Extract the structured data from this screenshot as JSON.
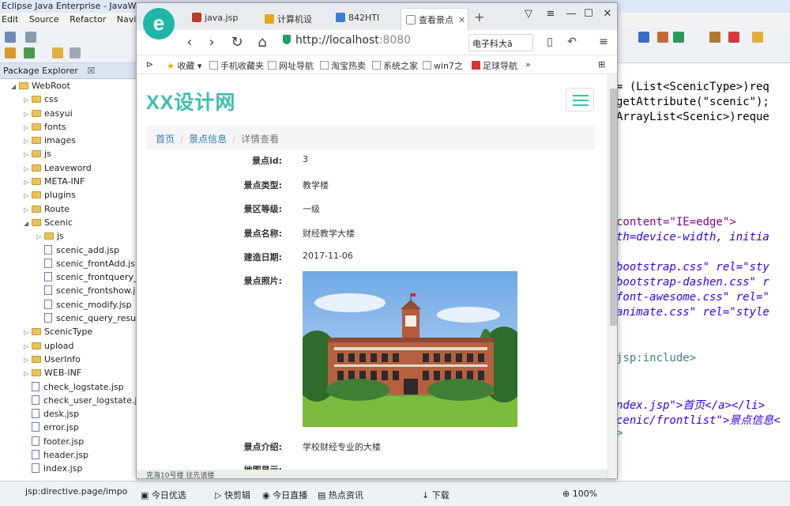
{
  "eclipse": {
    "title": "Eclipse Java Enterprise - JavaWebP",
    "menu": [
      "Edit",
      "Source",
      "Refactor",
      "Navigat"
    ],
    "package_explorer": {
      "title": "Package Explorer",
      "close": "☒",
      "items": [
        {
          "label": "WebRoot",
          "type": "folder",
          "depth": 0,
          "open": true
        },
        {
          "label": "css",
          "type": "folder",
          "depth": 1
        },
        {
          "label": "easyui",
          "type": "folder",
          "depth": 1
        },
        {
          "label": "fonts",
          "type": "folder",
          "depth": 1
        },
        {
          "label": "images",
          "type": "folder",
          "depth": 1
        },
        {
          "label": "js",
          "type": "folder",
          "depth": 1
        },
        {
          "label": "Leaveword",
          "type": "folder",
          "depth": 1
        },
        {
          "label": "META-INF",
          "type": "folder",
          "depth": 1
        },
        {
          "label": "plugins",
          "type": "folder",
          "depth": 1
        },
        {
          "label": "Route",
          "type": "folder",
          "depth": 1
        },
        {
          "label": "Scenic",
          "type": "folder",
          "depth": 1,
          "open": true
        },
        {
          "label": "js",
          "type": "folder",
          "depth": 2
        },
        {
          "label": "scenic_add.jsp",
          "type": "file",
          "depth": 2
        },
        {
          "label": "scenic_frontAdd.js",
          "type": "file",
          "depth": 2
        },
        {
          "label": "scenic_frontquery_",
          "type": "file",
          "depth": 2
        },
        {
          "label": "scenic_frontshow.j",
          "type": "file",
          "depth": 2
        },
        {
          "label": "scenic_modify.jsp",
          "type": "file",
          "depth": 2
        },
        {
          "label": "scenic_query_resu",
          "type": "file",
          "depth": 2
        },
        {
          "label": "ScenicType",
          "type": "folder",
          "depth": 1
        },
        {
          "label": "upload",
          "type": "folder",
          "depth": 1
        },
        {
          "label": "UserInfo",
          "type": "folder",
          "depth": 1
        },
        {
          "label": "WEB-INF",
          "type": "folder",
          "depth": 1
        },
        {
          "label": "check_logstate.jsp",
          "type": "file",
          "depth": 1
        },
        {
          "label": "check_user_logstate.j",
          "type": "file",
          "depth": 1
        },
        {
          "label": "desk.jsp",
          "type": "file",
          "depth": 1
        },
        {
          "label": "error.jsp",
          "type": "file",
          "depth": 1
        },
        {
          "label": "footer.jsp",
          "type": "file",
          "depth": 1
        },
        {
          "label": "header.jsp",
          "type": "file",
          "depth": 1
        },
        {
          "label": "index.jsp",
          "type": "file",
          "depth": 1
        }
      ]
    },
    "code_lines": [
      {
        "text": "= (List<ScenicType>)req",
        "cls": "c-txt"
      },
      {
        "text": "getAttribute(\"scenic\");",
        "cls": "c-txt"
      },
      {
        "text": "ArrayList<Scenic>)reque",
        "cls": "c-txt"
      },
      {
        "text": " content=\"IE=edge\">",
        "cls": "c-attr"
      },
      {
        "text": "th=device-width, initia",
        "cls": "c-str"
      },
      {
        "text": "bootstrap.css\" rel=\"sty",
        "cls": "c-str"
      },
      {
        "text": "bootstrap-dashen.css\" r",
        "cls": "c-str"
      },
      {
        "text": "font-awesome.css\" rel=\"",
        "cls": "c-str"
      },
      {
        "text": "animate.css\" rel=\"style",
        "cls": "c-str"
      },
      {
        "text": "jsp:include>",
        "cls": "c-tag"
      },
      {
        "text": "ndex.jsp\">首页</a></li>",
        "cls": "c-str"
      },
      {
        "text": "cenic/frontlist\">景点信息<",
        "cls": "c-str"
      },
      {
        "text": ">",
        "cls": "c-tag"
      }
    ],
    "status_text": "jsp:directive.page/impo"
  },
  "browser": {
    "logo": "e",
    "tabs": [
      {
        "label": "java.jsp",
        "color": "#c0392b"
      },
      {
        "label": "计算机设",
        "color": "#e6a817"
      },
      {
        "label": "842HTI",
        "color": "#3b7ddd"
      },
      {
        "label": "查看景点",
        "color": "#ffffff",
        "active": true
      }
    ],
    "new_tab": "+",
    "url": {
      "host": "http://localhost",
      "port": ":8080"
    },
    "search_text": "电子科大ā",
    "bookmarks": [
      "收藏",
      "手机收藏夹",
      "网址导航",
      "淘宝热卖",
      "系统之家",
      "win7之",
      "足球导航"
    ]
  },
  "site": {
    "brand": "XX设计网",
    "breadcrumb": {
      "home": "首页",
      "list": "景点信息",
      "current": "详情查看"
    },
    "details": [
      {
        "label": "景点id:",
        "value": "3"
      },
      {
        "label": "景点类型:",
        "value": "教学楼"
      },
      {
        "label": "景区等级:",
        "value": "一级"
      },
      {
        "label": "景点名称:",
        "value": "财经教学大楼"
      },
      {
        "label": "建造日期:",
        "value": "2017-11-06"
      },
      {
        "label": "景点照片:",
        "value": ""
      }
    ],
    "intro_label": "景点介绍:",
    "intro_value": "学校财经专业的大楼",
    "map_label": "地图显示:",
    "map_text": "克海10号楼   往先请楼"
  },
  "taskbar": {
    "items": [
      "今日优选",
      "快剪辑",
      "今日直播",
      "热点资讯",
      "下载",
      "100%"
    ]
  }
}
